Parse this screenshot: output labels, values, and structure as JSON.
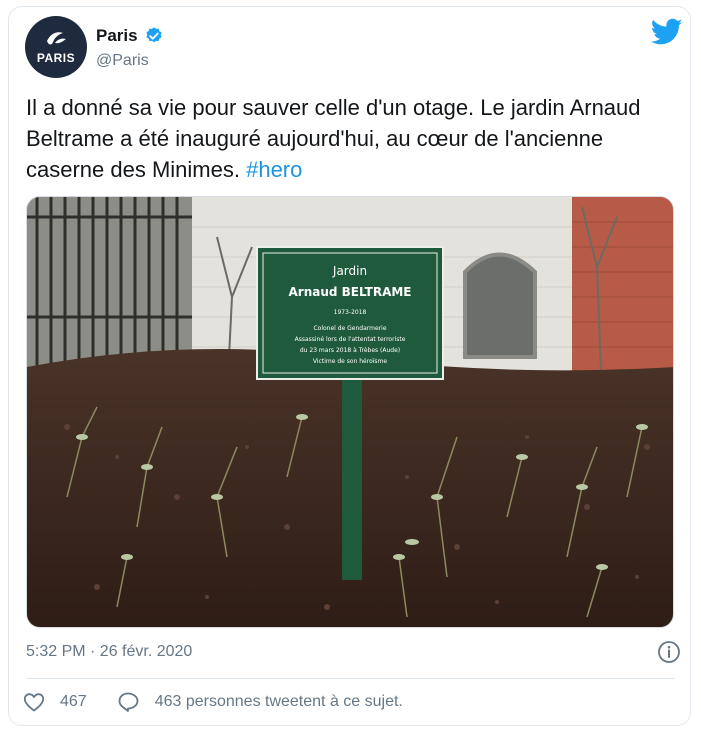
{
  "author": {
    "name": "Paris",
    "handle": "@Paris",
    "avatar_text": "PARIS"
  },
  "tweet": {
    "text": "Il a donné sa vie pour sauver celle d'un otage. Le jardin Arnaud Beltrame a été inauguré aujourd'hui, au cœur de l'ancienne caserne des Minimes. ",
    "hashtag": "#hero",
    "timestamp": "5:32 PM · 26 févr. 2020"
  },
  "sign": {
    "line1": "Jardin",
    "line2": "Arnaud BELTRAME",
    "line3": "1973-2018",
    "line4": "Colonel de Gendarmerie",
    "line5": "Assassiné lors de l'attentat terroriste",
    "line6": "du 23 mars 2018 à Trèbes (Aude)",
    "line7": "Victime de son héroïsme"
  },
  "actions": {
    "likes": "467",
    "replies_label": "463 personnes tweetent à ce sujet."
  },
  "colors": {
    "accent": "#1b95e0",
    "twitter_blue": "#1da1f2",
    "text": "#14171a",
    "muted": "#657786"
  },
  "icons": {
    "verified": "verified-badge-icon",
    "brand": "twitter-bird-icon",
    "info": "info-icon",
    "like": "heart-icon",
    "reply": "speech-bubble-icon"
  }
}
